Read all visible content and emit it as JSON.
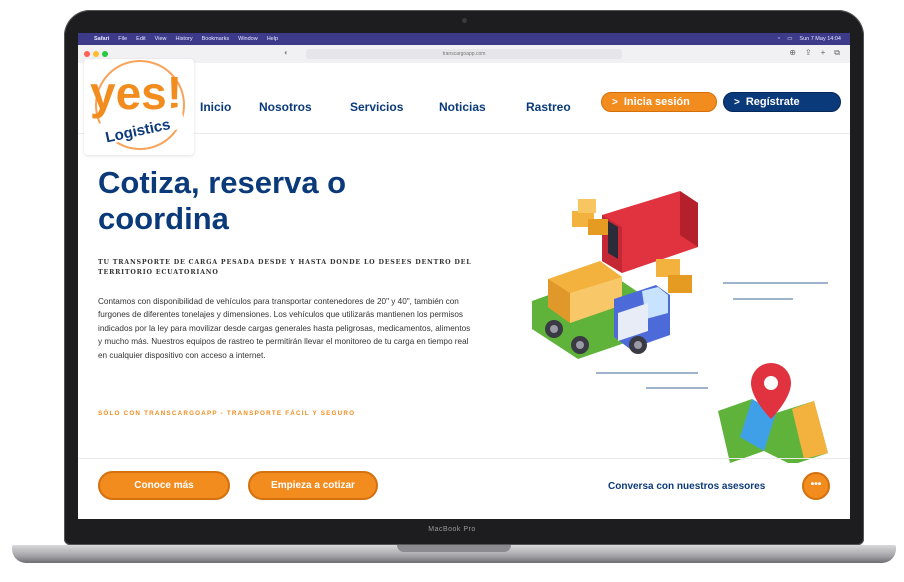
{
  "menubar": {
    "items": [
      "Safari",
      "File",
      "Edit",
      "View",
      "History",
      "Bookmarks",
      "Window",
      "Help"
    ],
    "clock": "Sun 7 May 14:04"
  },
  "browser": {
    "url": "transcargoapp.com"
  },
  "logo": {
    "text": "yes!",
    "subtext": "Logistics"
  },
  "nav": {
    "items": [
      "Inicio",
      "Nosotros",
      "Servicios",
      "Noticias",
      "Rastreo"
    ],
    "login_label": "Inicia sesión",
    "register_label": "Regístrate"
  },
  "hero": {
    "title_line1": "Cotiza, reserva o",
    "title_line2": "coordina",
    "subtitle": "TU TRANSPORTE DE CARGA PESADA DESDE Y HASTA DONDE LO DESEES DENTRO DEL TERRITORIO ECUATORIANO",
    "body": "Contamos con disponibilidad de vehículos para transportar contenedores de 20\" y 40\", también con furgones de diferentes tonelajes y dimensiones. Los vehículos que utilizarás mantienen los permisos indicados por la ley para movilizar desde cargas generales hasta peligrosas, medicamentos, alimentos y mucho más. Nuestros equipos de rastreo te permitirán llevar el monitoreo de tu carga en tiempo real en cualquier dispositivo con acceso a internet.",
    "tagline": "SÓLO CON TRANSCARGOAPP - TRANSPORTE FÁCIL Y SEGURO"
  },
  "cta": {
    "primary": "Conoce más",
    "secondary": "Empieza a cotizar",
    "chat_label": "Conversa con nuestros asesores",
    "chat_icon_glyph": "•••"
  },
  "device": {
    "label": "MacBook Pro"
  },
  "colors": {
    "brand_blue": "#0b3a7a",
    "brand_orange": "#f28c1f"
  },
  "icons": [
    "apple-icon",
    "wifi-icon",
    "share-icon",
    "plus-icon",
    "tabs-icon",
    "chevron-right-icon",
    "chat-icon",
    "truck-illustration",
    "map-pin-illustration"
  ]
}
